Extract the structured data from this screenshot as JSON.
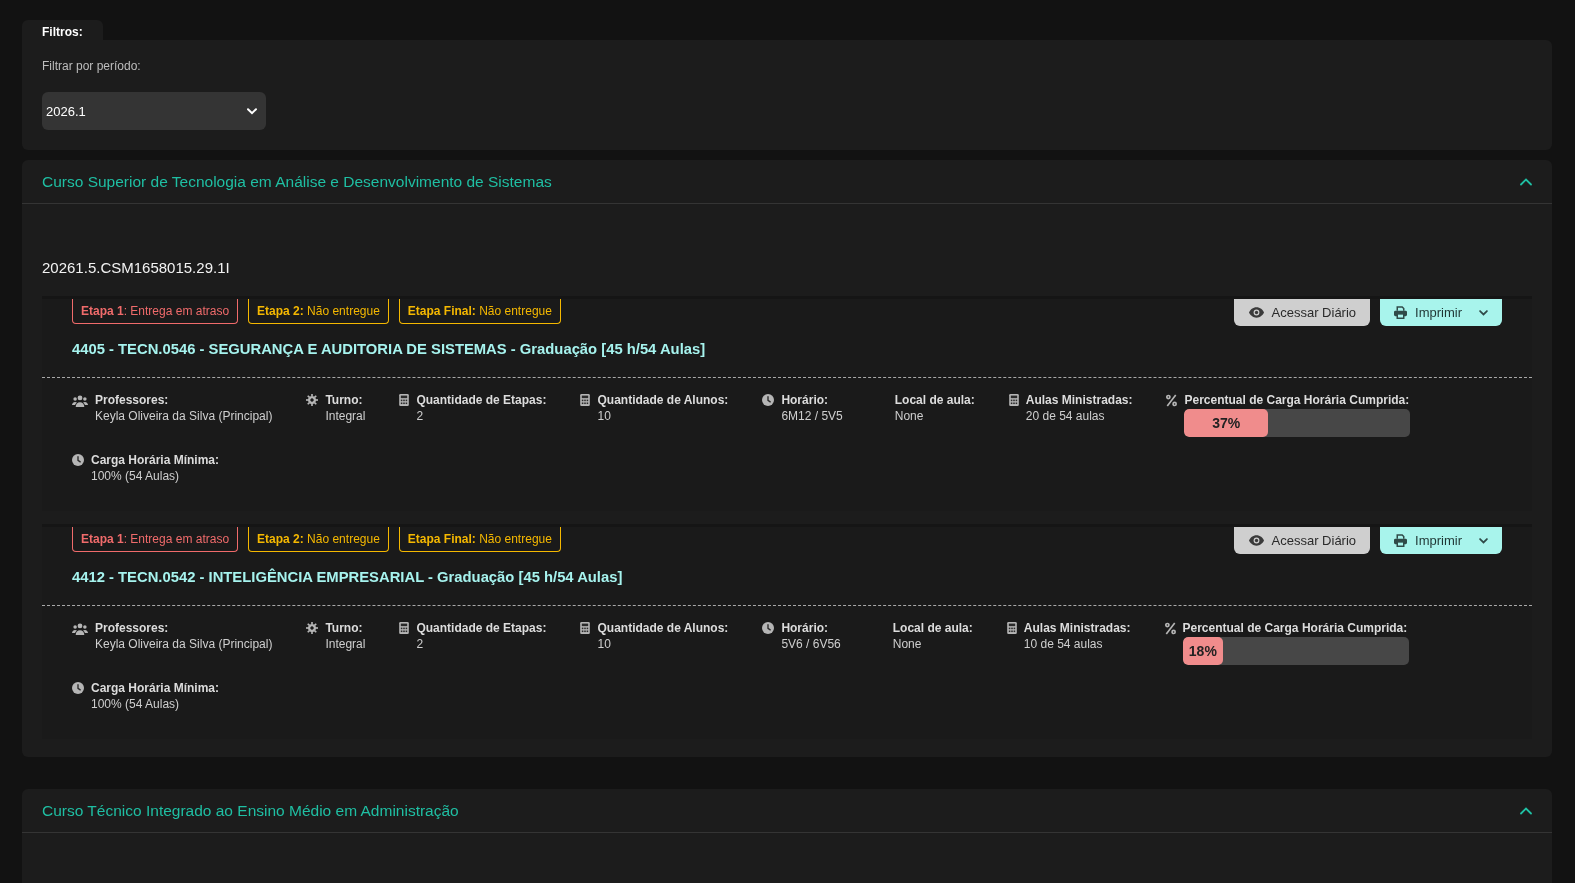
{
  "filters": {
    "tab": "Filtros:",
    "label": "Filtrar por período:",
    "period": "2026.1"
  },
  "courses": [
    {
      "title": "Curso Superior de Tecnologia em Análise e Desenvolvimento de Sistemas",
      "expanded": true,
      "groups": [
        {
          "code": "20261.5.CSM1658015.29.1I",
          "diaries": [
            {
              "stages": [
                {
                  "text": "**Etapa 1**: Entrega em atraso",
                  "color": "#f06b6b"
                },
                {
                  "text": "**Etapa 2:** Não entregue",
                  "color": "#f5b800"
                },
                {
                  "text": "**Etapa Final:** Não entregue",
                  "color": "#f5b800"
                }
              ],
              "actions": [
                {
                  "kind": "view",
                  "label": "Acessar Diário"
                },
                {
                  "kind": "print",
                  "label": "Imprimir"
                }
              ],
              "title": "4405 - TECN.0546 - SEGURANÇA E AUDITORIA DE SISTEMAS - Graduação [45 h/54 Aulas]",
              "details": [
                {
                  "kind": "professors",
                  "label": "Professores:",
                  "value": "Keyla Oliveira da Silva (Principal)"
                },
                {
                  "kind": "shift",
                  "label": "Turno:",
                  "value": "Integral"
                },
                {
                  "kind": "stages",
                  "label": "Quantidade de Etapas:",
                  "value": "2"
                },
                {
                  "kind": "students",
                  "label": "Quantidade de Alunos:",
                  "value": "10"
                },
                {
                  "kind": "schedule",
                  "label": "Horário:",
                  "value": "6M12 / 5V5"
                },
                {
                  "kind": "location",
                  "label": "Local de aula:",
                  "value": "None"
                },
                {
                  "kind": "lessons",
                  "label": "Aulas Ministradas:",
                  "value": "20 de 54 aulas"
                },
                {
                  "kind": "progress",
                  "label": "Percentual de Carga Horária Cumprida:",
                  "level": 0.37,
                  "reading": "37%"
                },
                {
                  "kind": "minimum",
                  "label": "Carga Horária Mínima:",
                  "value": "100% (54 Aulas)"
                }
              ]
            },
            {
              "stages": [
                {
                  "text": "**Etapa 1**: Entrega em atraso",
                  "color": "#f06b6b"
                },
                {
                  "text": "**Etapa 2:** Não entregue",
                  "color": "#f5b800"
                },
                {
                  "text": "**Etapa Final:** Não entregue",
                  "color": "#f5b800"
                }
              ],
              "actions": [
                {
                  "kind": "view",
                  "label": "Acessar Diário"
                },
                {
                  "kind": "print",
                  "label": "Imprimir"
                }
              ],
              "title": "4412 - TECN.0542 - INTELIGÊNCIA EMPRESARIAL - Graduação [45 h/54 Aulas]",
              "details": [
                {
                  "kind": "professors",
                  "label": "Professores:",
                  "value": "Keyla Oliveira da Silva (Principal)"
                },
                {
                  "kind": "shift",
                  "label": "Turno:",
                  "value": "Integral"
                },
                {
                  "kind": "stages",
                  "label": "Quantidade de Etapas:",
                  "value": "2"
                },
                {
                  "kind": "students",
                  "label": "Quantidade de Alunos:",
                  "value": "10"
                },
                {
                  "kind": "schedule",
                  "label": "Horário:",
                  "value": "5V6 / 6V56"
                },
                {
                  "kind": "location",
                  "label": "Local de aula:",
                  "value": "None"
                },
                {
                  "kind": "lessons",
                  "label": "Aulas Ministradas:",
                  "value": "10 de 54 aulas"
                },
                {
                  "kind": "progress",
                  "label": "Percentual de Carga Horária Cumprida:",
                  "level": 0.18,
                  "reading": "18%"
                },
                {
                  "kind": "minimum",
                  "label": "Carga Horária Mínima:",
                  "value": "100% (54 Aulas)"
                }
              ]
            }
          ]
        }
      ]
    },
    {
      "title": "Curso Técnico Integrado ao Ensino Médio em Administração",
      "expanded": true
    }
  ]
}
